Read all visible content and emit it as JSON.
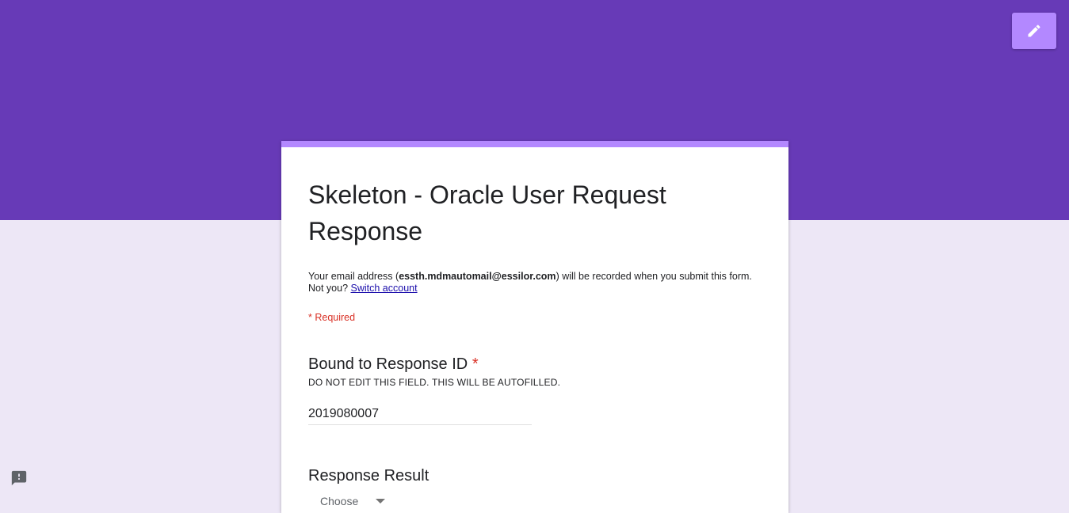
{
  "header": {
    "edit_icon": "pencil-icon",
    "banner_color": "#673ab7",
    "accent_color": "#b388ff"
  },
  "form": {
    "title": "Skeleton - Oracle User Request Response",
    "email_prefix": "Your email address (",
    "email": "essth.mdmautomail@essilor.com",
    "email_suffix": ") will be recorded when you submit this form. Not you?",
    "switch_account": "Switch account",
    "required_note": "* Required"
  },
  "questions": [
    {
      "title": "Bound to Response ID",
      "required_mark": "*",
      "help": "DO NOT EDIT THIS FIELD. THIS WILL BE AUTOFILLED.",
      "value": "2019080007"
    },
    {
      "title": "Response Result",
      "dropdown_value": "Choose"
    }
  ],
  "footer": {
    "feedback_icon": "feedback-icon"
  }
}
